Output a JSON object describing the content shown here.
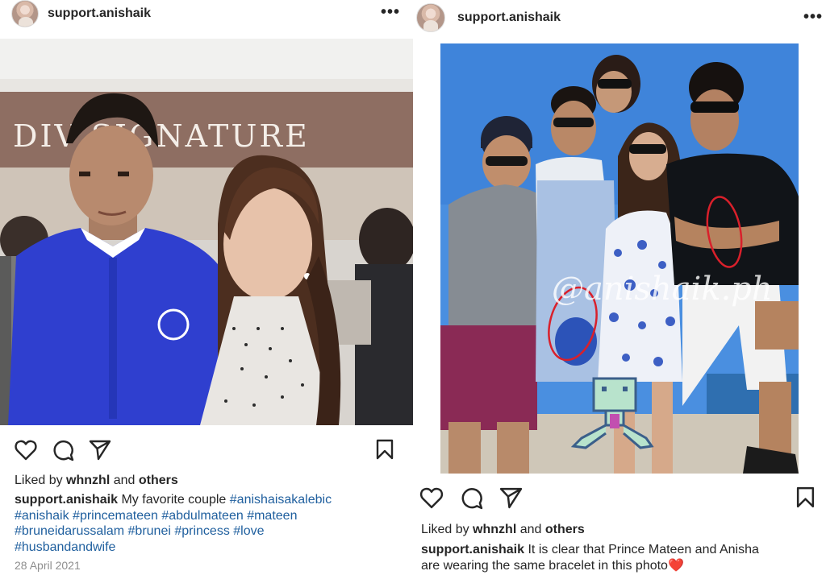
{
  "left_post": {
    "username": "support.anishaik",
    "image_sign_text": "DIV   SIGNATURE",
    "liked_by_prefix": "Liked by ",
    "liked_by_user": "whnzhl",
    "liked_by_and": " and ",
    "liked_by_others": "others",
    "caption_username": "support.anishaik",
    "caption_text": " My favorite couple ",
    "hashtags_line1": "#anishaisakalebic",
    "hashtags_line2": "#anishaik #princemateen #abdulmateen #mateen",
    "hashtags_line3": "#bruneidarussalam #brunei #princess #love",
    "hashtags_line4": "#husbandandwife",
    "date": "28 April 2021"
  },
  "right_post": {
    "username": "support.anishaik",
    "watermark": "@anishaik.ph",
    "liked_by_prefix": "Liked by ",
    "liked_by_user": "whnzhl",
    "liked_by_and": " and ",
    "liked_by_others": "others",
    "caption_username": "support.anishaik",
    "caption_line1": " It is clear that Prince Mateen and Anisha",
    "caption_line2": "are wearing the same bracelet in this photo",
    "caption_emoji": "❤️"
  },
  "icons": {
    "more": "more-options-icon",
    "like": "heart-icon",
    "comment": "comment-icon",
    "share": "send-icon",
    "save": "bookmark-icon"
  },
  "colors": {
    "hashtag": "#1f5f9e",
    "annotation_red": "#d9202b",
    "date_gray": "#8e8e8e"
  }
}
